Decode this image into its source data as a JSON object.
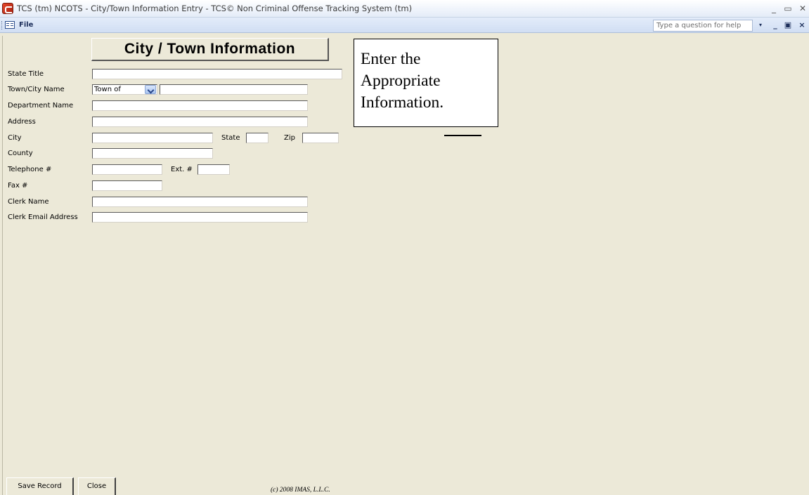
{
  "window": {
    "title": "TCS (tm) NCOTS - City/Town Information Entry - TCS© Non Criminal Offense Tracking System (tm)",
    "minimize_glyph": "_",
    "restore_glyph": "▭",
    "close_glyph": "✕"
  },
  "menubar": {
    "file_label": "File",
    "help_placeholder": "Type a question for help",
    "help_drop_glyph": "▾",
    "mdi_min_glyph": "_",
    "mdi_restore_glyph": "▣",
    "mdi_close_glyph": "×"
  },
  "form": {
    "title": "City / Town Information",
    "fields": {
      "state_title": {
        "label": "State Title",
        "value": ""
      },
      "town_city_name": {
        "label": "Town/City Name",
        "prefix_value": "Town of",
        "value": ""
      },
      "department_name": {
        "label": "Department Name",
        "value": ""
      },
      "address": {
        "label": "Address",
        "value": ""
      },
      "city": {
        "label": "City",
        "value": ""
      },
      "state": {
        "label": "State",
        "value": ""
      },
      "zip": {
        "label": "Zip",
        "value": ""
      },
      "county": {
        "label": "County",
        "value": ""
      },
      "telephone": {
        "label": "Telephone #",
        "value": ""
      },
      "ext": {
        "label": "Ext. #",
        "value": ""
      },
      "fax": {
        "label": "Fax #",
        "value": ""
      },
      "clerk_name": {
        "label": "Clerk Name",
        "value": ""
      },
      "clerk_email": {
        "label": "Clerk Email Address",
        "value": ""
      }
    }
  },
  "callout": {
    "lines": [
      "Enter the",
      "Appropriate",
      "Information."
    ]
  },
  "footer": {
    "save_label": "Save Record",
    "close_label": "Close",
    "copyright": "(c) 2008 IMAS, L.L.C."
  }
}
